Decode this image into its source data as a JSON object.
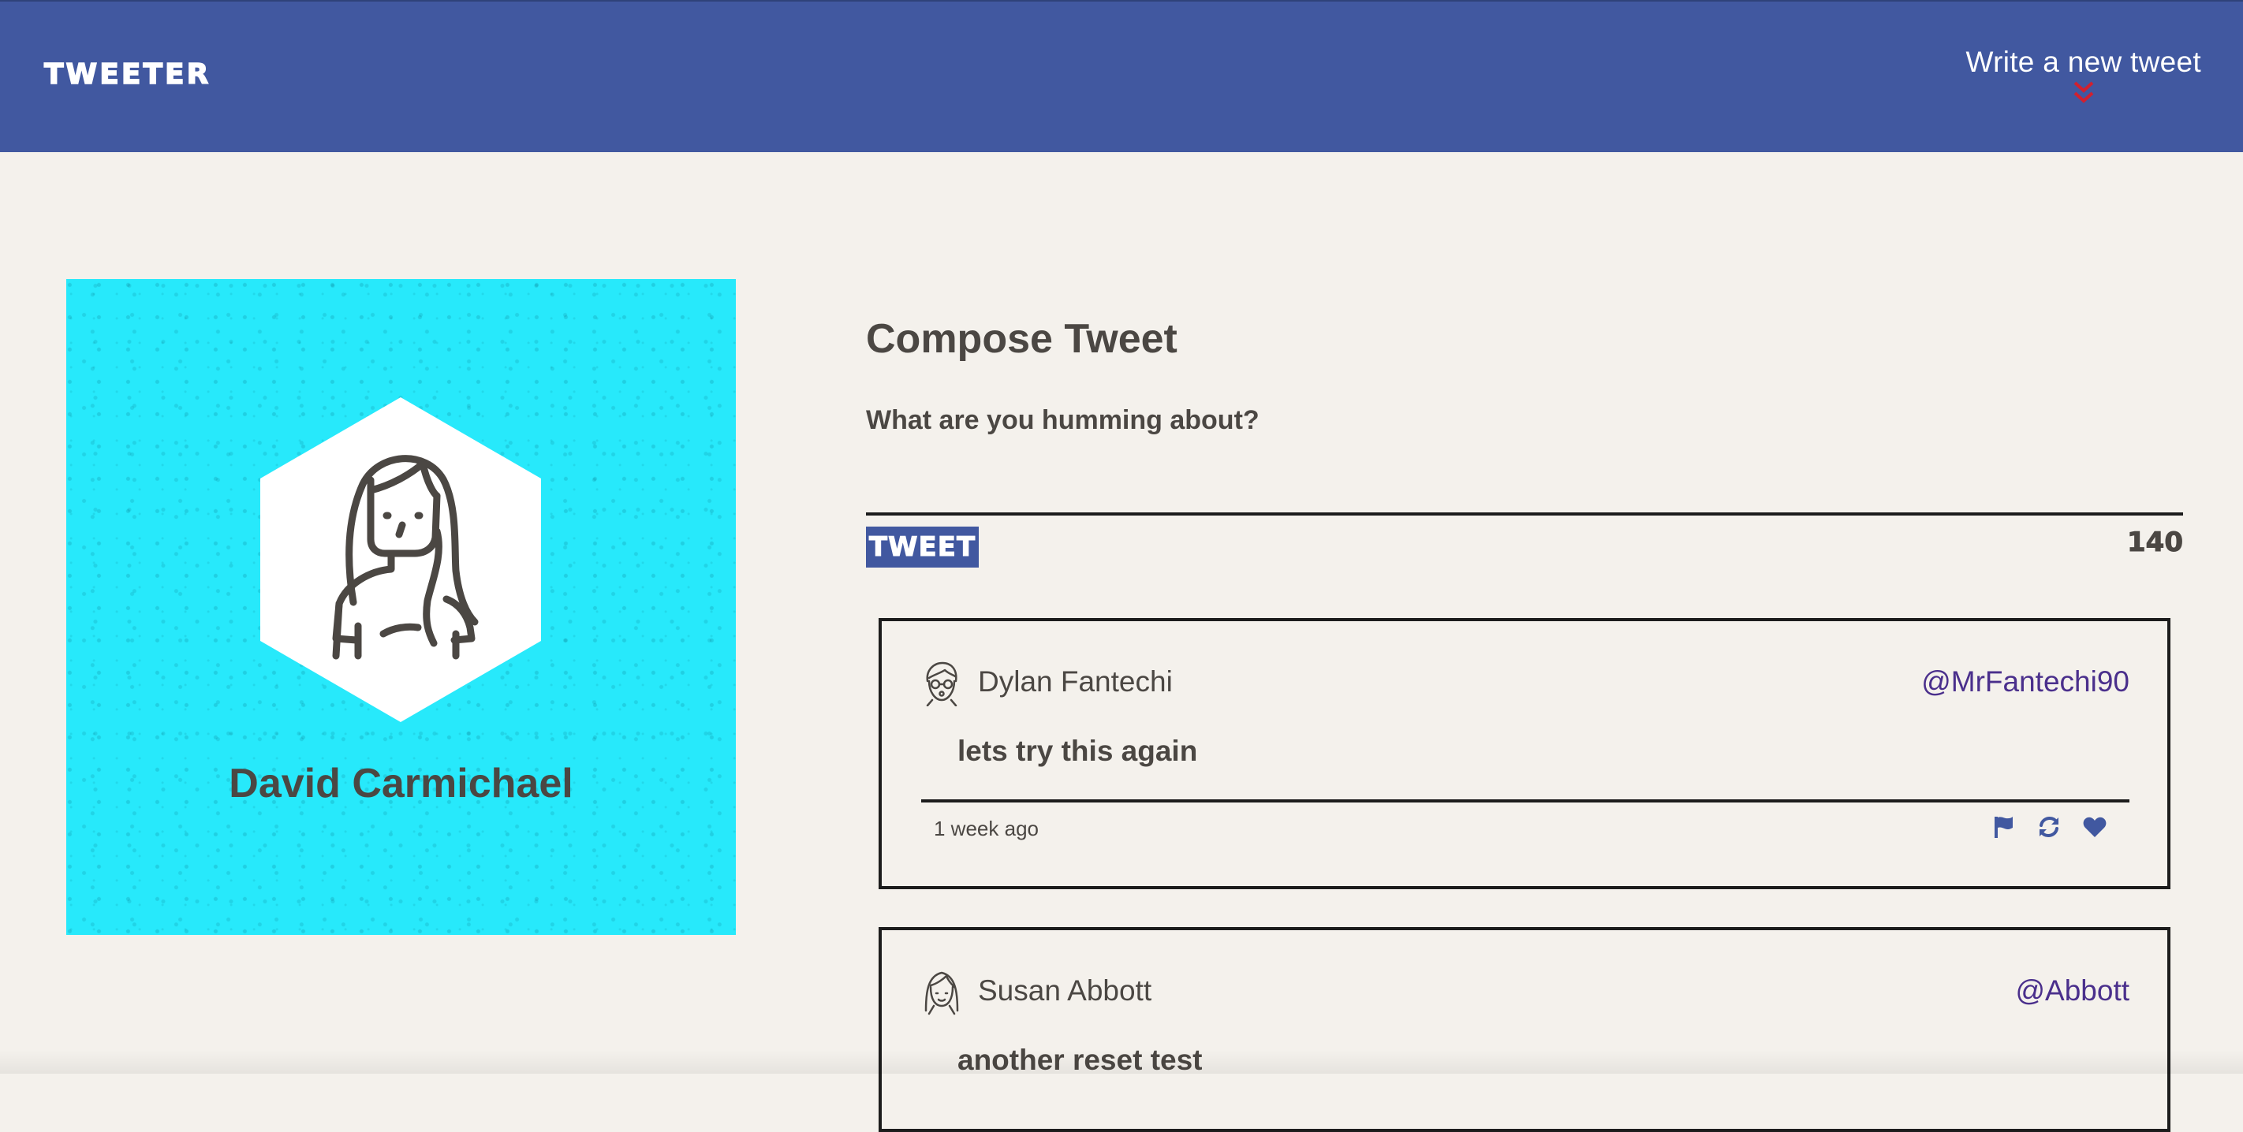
{
  "nav": {
    "logo": "TWEETER",
    "write_label": "Write a new tweet",
    "arrow_icon": "double-chevron-down-icon",
    "arrow_color": "#d1202f",
    "background": "#4158a0"
  },
  "profile": {
    "name": "David Carmichael",
    "avatar_icon": "woman-avatar-icon",
    "background": "#27e9fb"
  },
  "compose": {
    "title": "Compose Tweet",
    "placeholder": "What are you humming about?",
    "value": "",
    "button_label": "TWEET",
    "counter": "140"
  },
  "tweets": [
    {
      "name": "Dylan Fantechi",
      "handle": "@MrFantechi90",
      "content": "lets try this again",
      "time": "1 week ago",
      "avatar_icon": "man-glasses-avatar-icon",
      "actions": [
        "flag-icon",
        "retweet-icon",
        "heart-icon"
      ]
    },
    {
      "name": "Susan Abbott",
      "handle": "@Abbott",
      "content": "another reset test",
      "avatar_icon": "woman-avatar-icon"
    }
  ],
  "colors": {
    "accent": "#4158a0",
    "handle": "#4a2f8c",
    "page_bg": "#f4f1ec",
    "text": "#4b4743"
  }
}
